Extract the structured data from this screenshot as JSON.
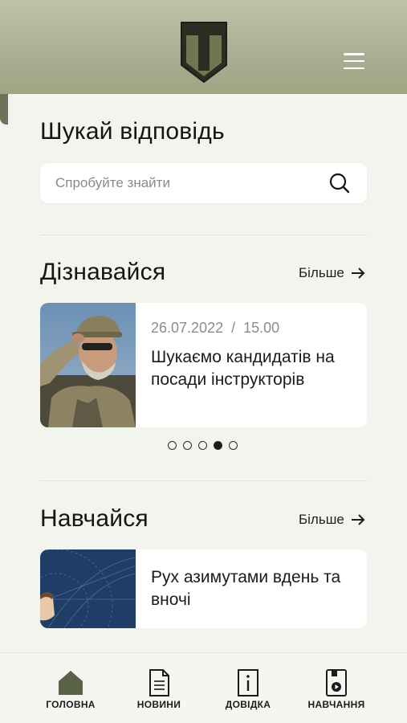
{
  "header": {
    "logo_icon": "shield-logo-icon",
    "menu_icon": "hamburger-menu-icon"
  },
  "search": {
    "title": "Шукай відповідь",
    "placeholder": "Спробуйте знайти"
  },
  "discover": {
    "title": "Дізнавайся",
    "more_label": "Більше",
    "news": {
      "date": "26.07.2022  /  15.00",
      "title": "Шукаємо кандидатів на посади інструкторів"
    },
    "carousel": {
      "total": 5,
      "active_index": 3
    }
  },
  "learn": {
    "title": "Навчайся",
    "more_label": "Більше",
    "item_title": "Рух азимутами вдень та вночі"
  },
  "bottom_nav": [
    {
      "label": "ГОЛОВНА",
      "icon": "home-icon",
      "active": true
    },
    {
      "label": "НОВИНИ",
      "icon": "document-icon",
      "active": false
    },
    {
      "label": "ДОВІДКА",
      "icon": "info-icon",
      "active": false
    },
    {
      "label": "НАВЧАННЯ",
      "icon": "play-book-icon",
      "active": false
    }
  ],
  "colors": {
    "header": "#aab094",
    "accent": "#5a6248",
    "background": "#f2f4ee"
  }
}
